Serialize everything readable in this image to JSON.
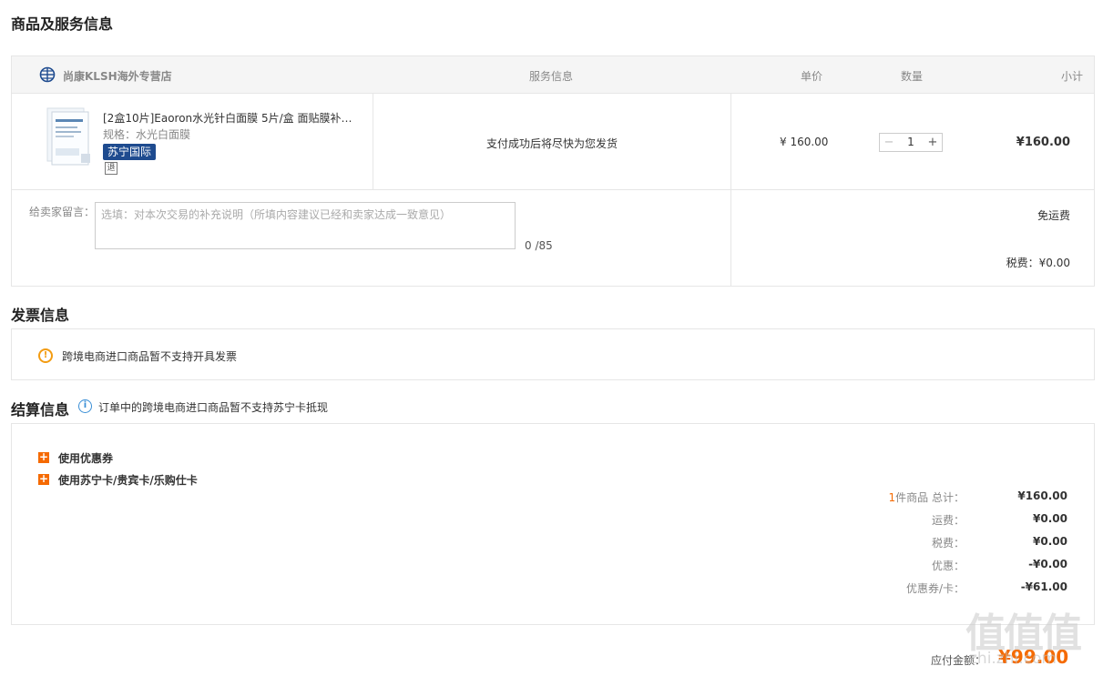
{
  "sections": {
    "goods_title": "商品及服务信息",
    "invoice_title": "发票信息",
    "settle_title": "结算信息"
  },
  "goods": {
    "store_name": "尚康KLSH海外专营店",
    "headers": {
      "service": "服务信息",
      "unit_price": "单价",
      "quantity": "数量",
      "subtotal": "小计"
    },
    "item": {
      "name": "[2盒10片]Eaoron水光针白面膜 5片/盒 面贴膜补水...",
      "spec": "规格：水光白面膜",
      "badge": "苏宁国际",
      "refund_icon_text": "退",
      "service": "支付成功后将尽快为您发货",
      "price": "¥ 160.00",
      "minus": "−",
      "quantity": "1",
      "plus": "+",
      "subtotal": "¥160.00"
    },
    "message": {
      "label": "给卖家留言：",
      "placeholder": "选填：对本次交易的补充说明（所填内容建议已经和卖家达成一致意见）",
      "counter": "0 /85"
    },
    "shipping": "免运费",
    "tax": "税费：¥0.00"
  },
  "invoice": {
    "notice": "跨境电商进口商品暂不支持开具发票",
    "icon": "warning-icon"
  },
  "settle": {
    "note": "订单中的跨境电商进口商品暂不支持苏宁卡抵现",
    "options": [
      "使用优惠券",
      "使用苏宁卡/贵宾卡/乐购仕卡"
    ],
    "summary": {
      "count": "1",
      "count_label": "件商品 总计：",
      "total": "¥160.00",
      "shipping_label": "运费：",
      "shipping": "¥0.00",
      "tax_label": "税费：",
      "tax": "¥0.00",
      "discount_label": "优惠：",
      "discount": "-¥0.00",
      "coupon_label": "优惠券/卡：",
      "coupon": "-¥61.00"
    },
    "pay_label": "应付金额：",
    "pay_amount": "¥99.00"
  },
  "watermark": {
    "mark": "值值值",
    "site": "zhi.zhi.com"
  },
  "colors": {
    "accent": "#f56a00",
    "badge_bg": "#1e4b8f",
    "info_blue": "#3a8fd6",
    "warn": "#f39c12"
  }
}
